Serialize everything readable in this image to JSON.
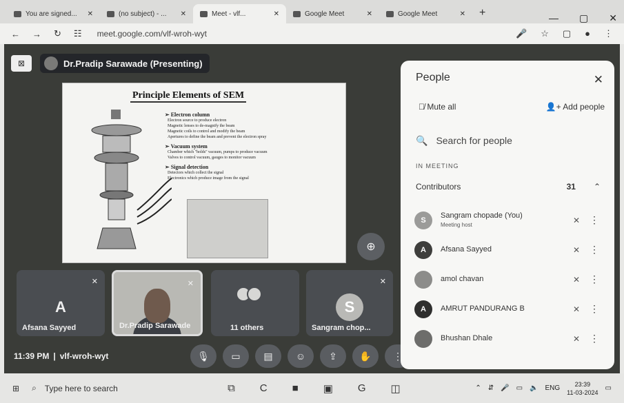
{
  "browser": {
    "tabs": [
      {
        "title": "You are signed...",
        "active": false
      },
      {
        "title": "(no subject) - ...",
        "active": false
      },
      {
        "title": "Meet - vlf...",
        "active": true
      },
      {
        "title": "Google Meet",
        "active": false
      },
      {
        "title": "Google Meet",
        "active": false
      }
    ],
    "url": "meet.google.com/vlf-wroh-wyt",
    "nav_icons": [
      "back-arrow-icon",
      "forward-arrow-icon",
      "reload-icon",
      "site-info-icon"
    ],
    "window_controls": [
      "minimize-icon",
      "maximize-icon",
      "close-icon"
    ]
  },
  "meeting": {
    "presenter_label": "Dr.Pradip Sarawade (Presenting)",
    "time": "11:39 PM",
    "code": "vlf-wroh-wyt",
    "slide": {
      "title": "Principle Elements of SEM",
      "sections": [
        {
          "heading": "Electron column",
          "lines": [
            "Electron source to produce electron",
            "Magnetic lenses to de-magnify the beam",
            "Magnetic coils to control and modify the beam",
            "Apertures to define the beam and prevent the electron spray"
          ]
        },
        {
          "heading": "Vacuum system",
          "lines": [
            "Chamber which \"holds\" vacuum, pumps to produce vacuum",
            "Valves to control vacuum, gauges to monitor vacuum"
          ]
        },
        {
          "heading": "Signal detection",
          "lines": [
            "Detectors which collect the signal",
            "Electronics which produce image from the signal"
          ]
        }
      ]
    },
    "tiles": [
      {
        "kind": "avatar",
        "letter": "A",
        "name": "Afsana Sayyed",
        "color": "#4f4f4d"
      },
      {
        "kind": "camera",
        "name": "Dr.Pradip Sarawade"
      },
      {
        "kind": "others",
        "name": "11 others"
      },
      {
        "kind": "avatar",
        "letter": "S",
        "name": "Sangram chop...",
        "color": "#b9b9b6"
      }
    ],
    "controls": [
      "mic-icon",
      "camera-icon",
      "captions-icon",
      "emoji-icon",
      "present-icon",
      "raise-hand-icon",
      "more-options-icon",
      "end-call-icon"
    ],
    "right_controls": {
      "items": [
        "info-icon",
        "people-icon",
        "chat-icon",
        "activities-icon",
        "lock-icon"
      ],
      "people_count": "31"
    }
  },
  "people_panel": {
    "title": "People",
    "mute_all": "Mute all",
    "add_people": "Add people",
    "search_placeholder": "Search for people",
    "section_label": "IN MEETING",
    "contributors_label": "Contributors",
    "contributors_count": "31",
    "people": [
      {
        "initial": "S",
        "name": "Sangram chopade (You)",
        "sub": "Meeting host",
        "color": "#9b9b99"
      },
      {
        "initial": "A",
        "name": "Afsana Sayyed",
        "sub": "",
        "color": "#3e3e3c"
      },
      {
        "initial": "",
        "name": "amol chavan",
        "sub": "",
        "color": "#8c8c8a"
      },
      {
        "initial": "A",
        "name": "AMRUT PANDURANG B",
        "sub": "",
        "color": "#2f2f2e"
      },
      {
        "initial": "",
        "name": "Bhushan Dhale",
        "sub": "",
        "color": "#6d6d6b"
      }
    ]
  },
  "taskbar": {
    "search_placeholder": "Type here to search",
    "apps": [
      "task-view-icon",
      "chrome-icon",
      "app-icon",
      "file-explorer-icon",
      "chrome-alt-icon",
      "app-alt-icon"
    ],
    "lang": "ENG",
    "time": "23:39",
    "date": "11-03-2024"
  }
}
